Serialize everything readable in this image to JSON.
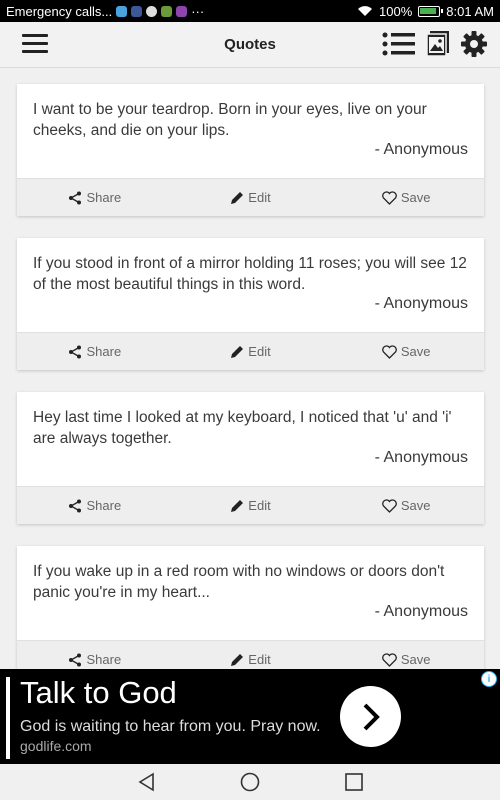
{
  "status_bar": {
    "notification_text": "Emergency calls...",
    "more_indicator": "···",
    "battery": "100%",
    "battery_level": 1.0,
    "time": "8:01 AM"
  },
  "app_bar": {
    "title": "Quotes"
  },
  "cards": [
    {
      "text": "I want to be your teardrop. Born in your eyes, live on your cheeks, and die on your lips.",
      "author": "- Anonymous"
    },
    {
      "text": "If you stood in front of a mirror holding 11 roses; you will see 12 of the most beautiful things in this word.",
      "author": "- Anonymous"
    },
    {
      "text": "Hey last time I looked at my keyboard, I noticed that 'u' and 'i' are always together.",
      "author": "- Anonymous"
    },
    {
      "text": "If you wake up in a red room with no windows or doors don't panic you're in my heart...",
      "author": "- Anonymous"
    }
  ],
  "actions": {
    "share": "Share",
    "edit": "Edit",
    "save": "Save"
  },
  "ad": {
    "headline": "Talk to God",
    "description": "God is waiting to hear from you. Pray now.",
    "url": "godlife.com"
  },
  "colors": {
    "status_bar_bg": "#000000",
    "app_bar_bg": "#f2f2f2",
    "card_actions_bg": "#eeeeee",
    "ad_bg": "#000000",
    "battery_green": "#4caf50",
    "ad_info_blue": "#29b6f6"
  }
}
